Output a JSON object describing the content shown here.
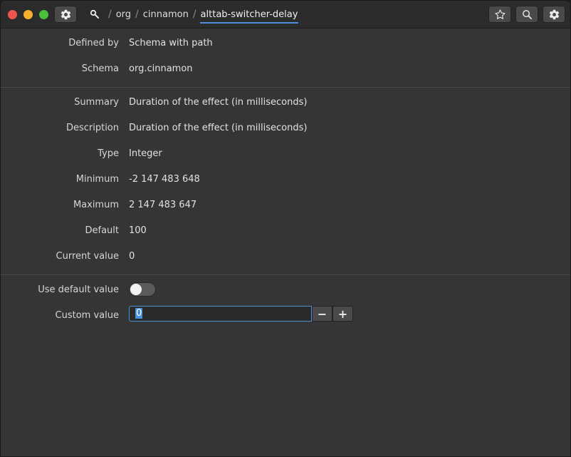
{
  "header": {
    "path": [
      "org",
      "cinnamon",
      "alttab-switcher-delay"
    ],
    "separator": "/"
  },
  "details": [
    {
      "label": "Defined by",
      "value": "Schema with path"
    },
    {
      "label": "Schema",
      "value": "org.cinnamon"
    },
    {
      "label": "Summary",
      "value": "Duration of the effect (in milliseconds)"
    },
    {
      "label": "Description",
      "value": "Duration of the effect (in milliseconds)"
    },
    {
      "label": "Type",
      "value": "Integer"
    },
    {
      "label": "Minimum",
      "value": "-2 147 483 648"
    },
    {
      "label": "Maximum",
      "value": "2 147 483 647"
    },
    {
      "label": "Default",
      "value": "100"
    },
    {
      "label": "Current value",
      "value": "0"
    }
  ],
  "controls": {
    "use_default_label": "Use default value",
    "use_default_on": false,
    "custom_value_label": "Custom value",
    "custom_value": "0",
    "minus": "−",
    "plus": "+"
  },
  "icons": {
    "app_menu": "gear-icon",
    "root": "root-path-icon",
    "bookmark": "star-icon",
    "search": "search-icon",
    "settings": "gear-icon"
  },
  "colors": {
    "accent": "#4a90d9",
    "close": "#ef5350",
    "minimize": "#f6b12f",
    "maximize": "#49c03a"
  }
}
